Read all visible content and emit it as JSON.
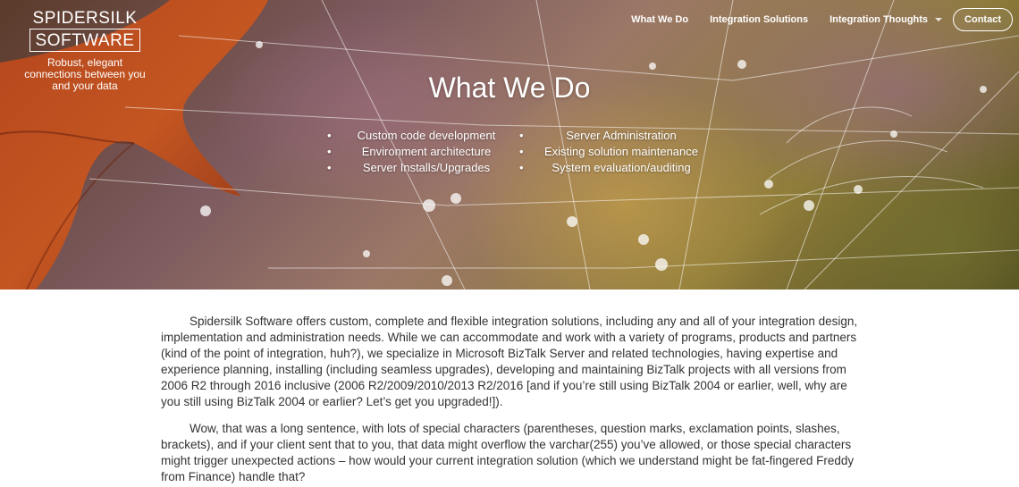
{
  "logo": {
    "line1": "SPIDERSILK",
    "line2": "SOFTWARE",
    "tagline": "Robust, elegant connections between you and your data"
  },
  "nav": {
    "items": [
      "What We Do",
      "Integration Solutions",
      "Integration Thoughts"
    ],
    "contact": "Contact"
  },
  "hero": {
    "title": "What We Do",
    "services_left": [
      "Custom code development",
      "Environment architecture",
      "Server Installs/Upgrades"
    ],
    "services_right": [
      "Server Administration",
      "Existing solution maintenance",
      "System evaluation/auditing"
    ]
  },
  "content": {
    "paragraphs": [
      "Spidersilk Software offers custom, complete and flexible integration solutions, including any and all of your integration design, implementation and administration needs. While we can accommodate and work with a variety of programs, products and partners (kind of the point of integration, huh?), we specialize in Microsoft BizTalk Server and related technologies, having expertise and experience planning, installing (including seamless upgrades), developing and maintaining BizTalk projects with all versions from 2006 R2 through 2016 inclusive (2006 R2/2009/2010/2013 R2/2016 [and if you’re still using BizTalk 2004 or earlier, well, why are you still using BizTalk 2004 or earlier? Let’s get you upgraded!]).",
      "Wow, that was a long sentence, with lots of special characters (parentheses, question marks, exclamation points, slashes, brackets), and if your client sent that to you, that data might overflow the varchar(255) you’ve allowed, or those special characters might trigger unexpected actions – how would your current integration solution (which we understand might be fat-fingered Freddy from Finance) handle that?"
    ]
  },
  "icons": {
    "dropdown": "chevron-down-icon"
  }
}
